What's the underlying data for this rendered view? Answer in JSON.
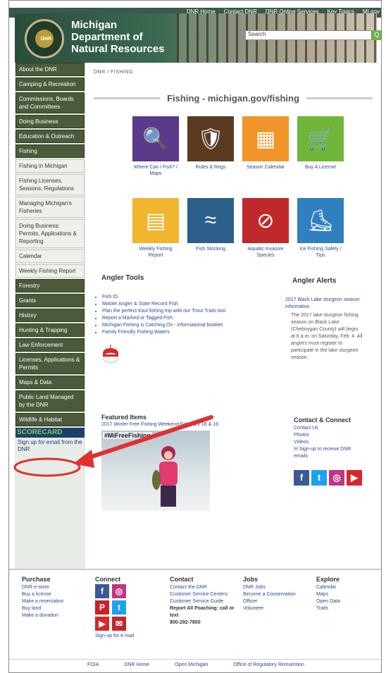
{
  "topnav": [
    "DNR Home",
    "Contact DNR",
    "DNR Online Services",
    "Key Topics",
    "MI.gov"
  ],
  "header": {
    "line1": "Michigan",
    "line2": "Department of",
    "line3": "Natural Resources",
    "logo_text": "DNR",
    "search_placeholder": "Search",
    "search_button": "Q"
  },
  "sidebar": {
    "items": [
      {
        "label": "About the DNR",
        "type": "main"
      },
      {
        "label": "Camping & Recreation",
        "type": "main"
      },
      {
        "label": "Commissions, Boards and Committees",
        "type": "main"
      },
      {
        "label": "Doing Business",
        "type": "main"
      },
      {
        "label": "Education & Outreach",
        "type": "main"
      },
      {
        "label": "Fishing",
        "type": "main"
      },
      {
        "label": "Fishing in Michigan",
        "type": "sub"
      },
      {
        "label": "Fishing Licenses, Seasons, Regulations",
        "type": "sub"
      },
      {
        "label": "Managing Michigan's Fisheries",
        "type": "sub"
      },
      {
        "label": "Doing Business: Permits, Applications & Reporting",
        "type": "sub"
      },
      {
        "label": "Calendar",
        "type": "sub"
      },
      {
        "label": "Weekly Fishing Report",
        "type": "sub"
      },
      {
        "label": "Forestry",
        "type": "main"
      },
      {
        "label": "Grants",
        "type": "main"
      },
      {
        "label": "History",
        "type": "main"
      },
      {
        "label": "Hunting & Trapping",
        "type": "main"
      },
      {
        "label": "Law Enforcement",
        "type": "main"
      },
      {
        "label": "Licenses, Applications & Permits",
        "type": "main"
      },
      {
        "label": "Maps & Data",
        "type": "main"
      },
      {
        "label": "Public Land Managed by the DNR",
        "type": "main"
      },
      {
        "label": "Wildlife & Habitat",
        "type": "main"
      }
    ],
    "scorecard": "SCORECARD",
    "signup": "Sign up for email from the DNR"
  },
  "breadcrumb": "DNR  /  FISHING",
  "section_title": "Fishing - michigan.gov/fishing",
  "tiles": [
    {
      "label": "Where Can I Fish? / Maps",
      "color": "#5a3a8a",
      "glyph": "🔍"
    },
    {
      "label": "Rules & Regs",
      "color": "#5a3b22",
      "glyph": "🛡"
    },
    {
      "label": "Season Calendar",
      "color": "#f0952a",
      "glyph": "▦"
    },
    {
      "label": "Buy A License",
      "color": "#6fb63a",
      "glyph": "🛒"
    },
    {
      "label": "Weekly Fishing Report",
      "color": "#f2b530",
      "glyph": "▤"
    },
    {
      "label": "Fish Stocking",
      "color": "#2c5f8a",
      "glyph": "≈"
    },
    {
      "label": "Aquatic Invasive Species",
      "color": "#c0282c",
      "glyph": "⊘"
    },
    {
      "label": "Ice Fishing Safety / Tips",
      "color": "#2f7fc1",
      "glyph": "⛸"
    }
  ],
  "angler_tools": {
    "heading": "Angler Tools",
    "links": [
      "Fish ID",
      "Master Angler & State Record Fish",
      "Plan the perfect trout fishing trip with our Trout Trails tool",
      "Report a Marked or Tagged Fish",
      "Michigan Fishing is Catching On - informational booklet",
      "Family Friendly Fishing Waters"
    ]
  },
  "angler_alerts": {
    "heading": "Angler Alerts",
    "link": "2017 Black Lake sturgeon season information",
    "text": "The 2017 lake sturgeon fishing season on Black Lake (Cheboygan County) will begin at 8 a.m. on Saturday, Feb. 4. All anglers must register to participate in the lake sturgeon season."
  },
  "featured": {
    "heading": "Featured Items",
    "link": "2017 Winter Free Fishing Weekend February 18 & 19",
    "hashtag": "#MiFreeFishing"
  },
  "contact_connect": {
    "heading": "Contact & Connect",
    "links": [
      "Contact Us",
      "Photos",
      "Videos"
    ],
    "signup": "Sign-up to receive DNR emails"
  },
  "footer": {
    "purchase": {
      "heading": "Purchase",
      "links": [
        "DNR e-store",
        "Buy a license",
        "Make a reservation",
        "Buy land",
        "Make a donation"
      ]
    },
    "connect": {
      "heading": "Connect",
      "signup": "Sign-up for e-mail"
    },
    "contact": {
      "heading": "Contact",
      "links": [
        "Contact the DNR",
        "Customer Service Centers",
        "Customer Service Guide"
      ],
      "poaching": "Report All Poaching: call or text",
      "phone": "800-292-7800"
    },
    "jobs": {
      "heading": "Jobs",
      "links": [
        "DNR Jobs",
        "Become a Conservation Officer",
        "Volunteer"
      ]
    },
    "explore": {
      "heading": "Explore",
      "links": [
        "Calendar",
        "Maps",
        "Open Data",
        "Trails"
      ]
    }
  },
  "bottom_links": [
    "FOIA",
    "DNR Home",
    "Open Michigan",
    "Office of Regulatory Reinvention"
  ],
  "colors": {
    "sidebar_green": "#4b5a3a",
    "link_blue": "#2a4b8d",
    "arrow_red": "#e03030"
  }
}
